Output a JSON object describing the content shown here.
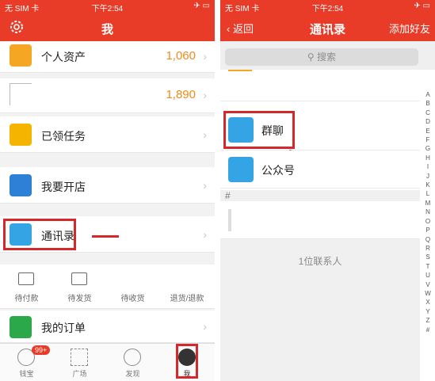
{
  "left_screen": {
    "status": {
      "carrier": "无 SIM 卡 ",
      "time": "下午2:54",
      "right": "✈ ▭"
    },
    "nav": {
      "title": "我"
    },
    "rows": [
      {
        "label": "个人资产",
        "value": "1,060"
      },
      {
        "label": "",
        "value": "1,890"
      },
      {
        "label": "已领任务",
        "value": ""
      },
      {
        "label": "我要开店",
        "value": ""
      },
      {
        "label": "通讯录",
        "value": ""
      },
      {
        "label": "我的订单",
        "value": ""
      }
    ],
    "orders": [
      "待付款",
      "待发货",
      "待收货",
      "退货/退款"
    ],
    "tabs": [
      {
        "label": "钱宝",
        "badge": "99+"
      },
      {
        "label": "广场"
      },
      {
        "label": "发现"
      },
      {
        "label": "我"
      }
    ]
  },
  "right_screen": {
    "status": {
      "carrier": "无 SIM 卡 ",
      "time": "下午2:54",
      "right": "✈ ▭"
    },
    "nav": {
      "back": "返回",
      "title": "通讯录",
      "action": "添加好友"
    },
    "search_placeholder": "搜索",
    "rows": [
      {
        "label": "群聊"
      },
      {
        "label": "公众号"
      }
    ],
    "section": "#",
    "count_text": "1位联系人",
    "alphabet": [
      "A",
      "B",
      "C",
      "D",
      "E",
      "F",
      "G",
      "H",
      "I",
      "J",
      "K",
      "L",
      "M",
      "N",
      "O",
      "P",
      "Q",
      "R",
      "S",
      "T",
      "U",
      "V",
      "W",
      "X",
      "Y",
      "Z",
      "#"
    ]
  },
  "colors": {
    "brand_red": "#e83c29",
    "highlight": "#d4282b",
    "value_orange": "#f08a1c",
    "blue_icon": "#35a4e4"
  }
}
